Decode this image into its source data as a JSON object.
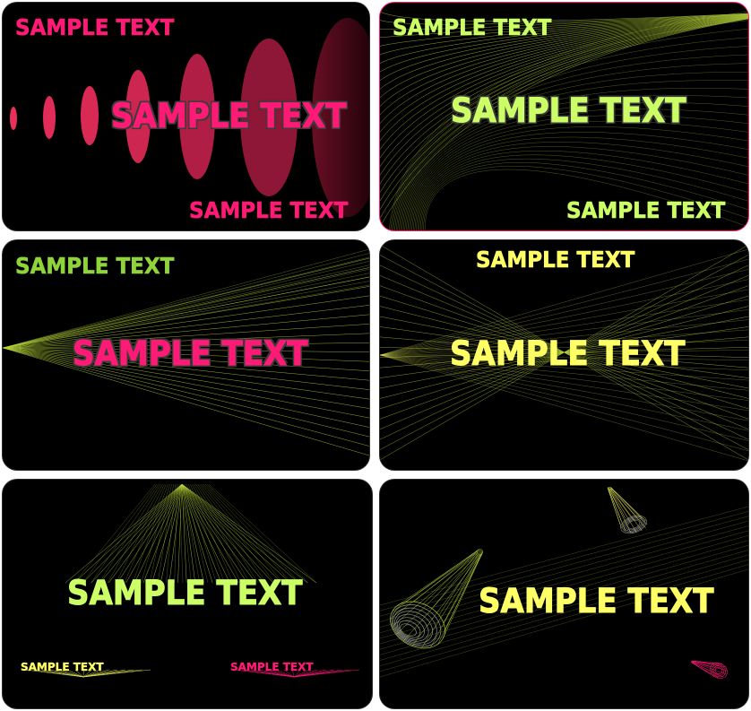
{
  "colors": {
    "pink": "#ff1a75",
    "lime": "#ccff66",
    "green": "#8fd43a",
    "yellow": "#ffff66",
    "background": "#000000"
  },
  "cards": [
    {
      "texts": {
        "top": "SAMPLE TEXT",
        "center": "SAMPLE TEXT",
        "bottom": "SAMPLE TEXT"
      }
    },
    {
      "texts": {
        "top": "SAMPLE TEXT",
        "center": "SAMPLE TEXT",
        "bottom": "SAMPLE TEXT"
      }
    },
    {
      "texts": {
        "top": "SAMPLE TEXT",
        "center": "SAMPLE TEXT"
      }
    },
    {
      "texts": {
        "top": "SAMPLE TEXT",
        "center": "SAMPLE TEXT"
      }
    },
    {
      "texts": {
        "center": "SAMPLE TEXT",
        "bottom_left": "SAMPLE TEXT",
        "bottom_right": "SAMPLE TEXT"
      }
    },
    {
      "texts": {
        "center": "SAMPLE TEXT"
      }
    }
  ]
}
